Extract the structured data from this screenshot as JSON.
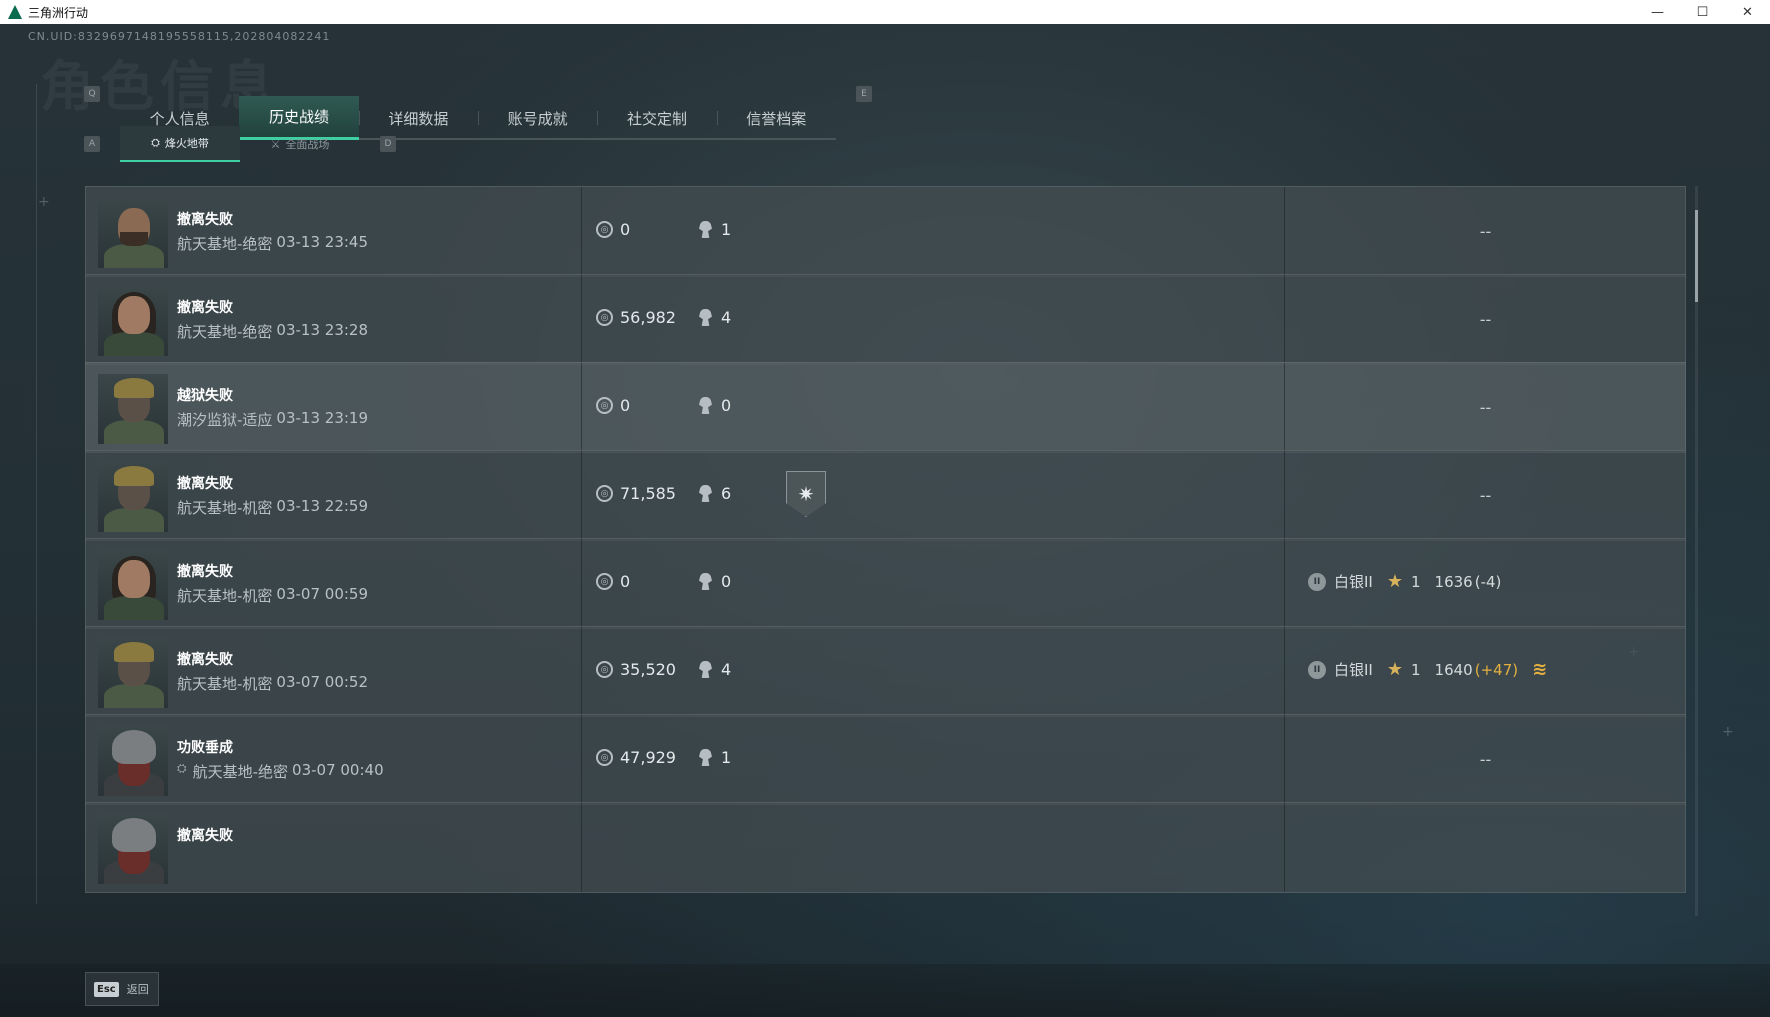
{
  "window": {
    "title": "三角洲行动",
    "min": "—",
    "max": "☐",
    "close": "✕"
  },
  "header": {
    "uid": "CN.UID:8329697148195558115,202804082241",
    "bg_title": "角色信息"
  },
  "key_hints": {
    "tabs_left": "Q",
    "tabs_right": "E",
    "subtabs_left": "A",
    "subtabs_right": "D"
  },
  "tabs": [
    {
      "label": "个人信息",
      "active": false
    },
    {
      "label": "历史战绩",
      "active": true
    },
    {
      "label": "详细数据",
      "active": false
    },
    {
      "label": "账号成就",
      "active": false
    },
    {
      "label": "社交定制",
      "active": false
    },
    {
      "label": "信誉档案",
      "active": false
    }
  ],
  "subtabs": [
    {
      "label": "烽火地带",
      "icon": "⛭",
      "active": true
    },
    {
      "label": "全面战场",
      "icon": "⚔",
      "active": false
    }
  ],
  "records": [
    {
      "result": "撤离失败",
      "map": "航天基地-绝密",
      "time": "03-13 23:45",
      "value": "0",
      "kills": "1",
      "badge": false,
      "rank": null,
      "avatar": "soldier"
    },
    {
      "result": "撤离失败",
      "map": "航天基地-绝密",
      "time": "03-13 23:28",
      "value": "56,982",
      "kills": "4",
      "badge": false,
      "rank": null,
      "avatar": "female"
    },
    {
      "result": "越狱失败",
      "map": "潮汐监狱-适应",
      "time": "03-13 23:19",
      "value": "0",
      "kills": "0",
      "badge": false,
      "rank": null,
      "avatar": "masked"
    },
    {
      "result": "撤离失败",
      "map": "航天基地-机密",
      "time": "03-13 22:59",
      "value": "71,585",
      "kills": "6",
      "badge": true,
      "rank": null,
      "avatar": "masked"
    },
    {
      "result": "撤离失败",
      "map": "航天基地-机密",
      "time": "03-07 00:59",
      "value": "0",
      "kills": "0",
      "badge": false,
      "rank": {
        "tier": "白银II",
        "stars": "1",
        "score": "1636",
        "delta": "(-4)",
        "up": false
      },
      "avatar": "female"
    },
    {
      "result": "撤离失败",
      "map": "航天基地-机密",
      "time": "03-07 00:52",
      "value": "35,520",
      "kills": "4",
      "badge": false,
      "rank": {
        "tier": "白银II",
        "stars": "1",
        "score": "1640",
        "delta": "(+47)",
        "up": true
      },
      "avatar": "masked"
    },
    {
      "result": "功败垂成",
      "map": "航天基地-绝密",
      "time": "03-07 00:40",
      "value": "47,929",
      "kills": "1",
      "badge": false,
      "rank": null,
      "avatar": "helmet",
      "map_icon": true
    },
    {
      "result": "撤离失败",
      "map": "",
      "time": "",
      "value": "",
      "kills": "",
      "badge": false,
      "rank": null,
      "avatar": "helmet"
    }
  ],
  "empty_rank": "--",
  "footer": {
    "esc_key": "Esc",
    "esc_label": "返回"
  },
  "colors": {
    "accent": "#3fd0a2",
    "rank_gold": "#e3b040",
    "row_bg": "#444e52"
  }
}
